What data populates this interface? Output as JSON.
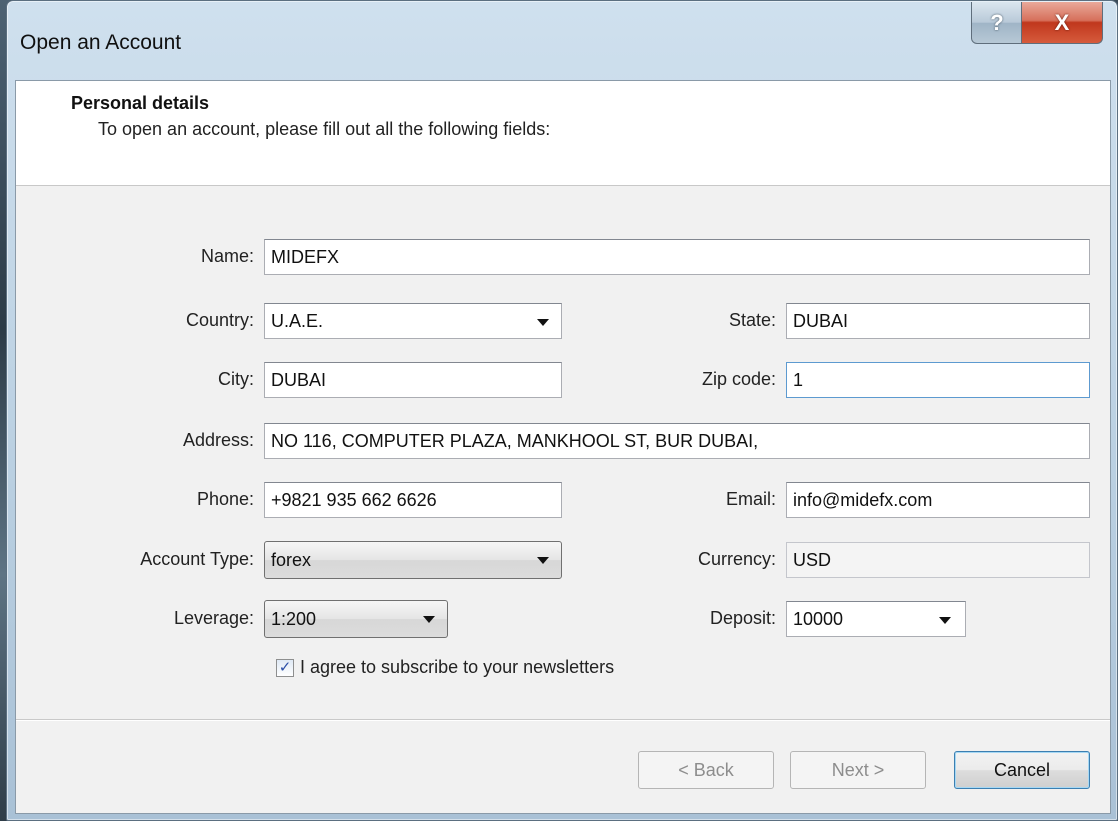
{
  "window": {
    "title": "Open an Account",
    "help_glyph": "?",
    "close_glyph": "X"
  },
  "header": {
    "title": "Personal details",
    "subtitle": "To open an account, please fill out all the following fields:"
  },
  "form": {
    "name": {
      "label": "Name:",
      "value": "MIDEFX"
    },
    "country": {
      "label": "Country:",
      "value": "U.A.E."
    },
    "state": {
      "label": "State:",
      "value": "DUBAI"
    },
    "city": {
      "label": "City:",
      "value": "DUBAI"
    },
    "zip": {
      "label": "Zip code:",
      "value": "1"
    },
    "address": {
      "label": "Address:",
      "value": "NO 116, COMPUTER PLAZA, MANKHOOL ST, BUR DUBAI,"
    },
    "phone": {
      "label": "Phone:",
      "value": "+9821 935 662 6626"
    },
    "email": {
      "label": "Email:",
      "value": "info@midefx.com"
    },
    "account_type": {
      "label": "Account Type:",
      "value": "forex"
    },
    "currency": {
      "label": "Currency:",
      "value": "USD"
    },
    "leverage": {
      "label": "Leverage:",
      "value": "1:200"
    },
    "deposit": {
      "label": "Deposit:",
      "value": "10000"
    },
    "newsletter": {
      "label": "I agree to subscribe to your newsletters",
      "checked": true,
      "glyph": "✓"
    }
  },
  "buttons": {
    "back": "< Back",
    "next": "Next >",
    "cancel": "Cancel"
  },
  "colors": {
    "accent_focus": "#5d9ad0",
    "close_red": "#c0371d"
  }
}
